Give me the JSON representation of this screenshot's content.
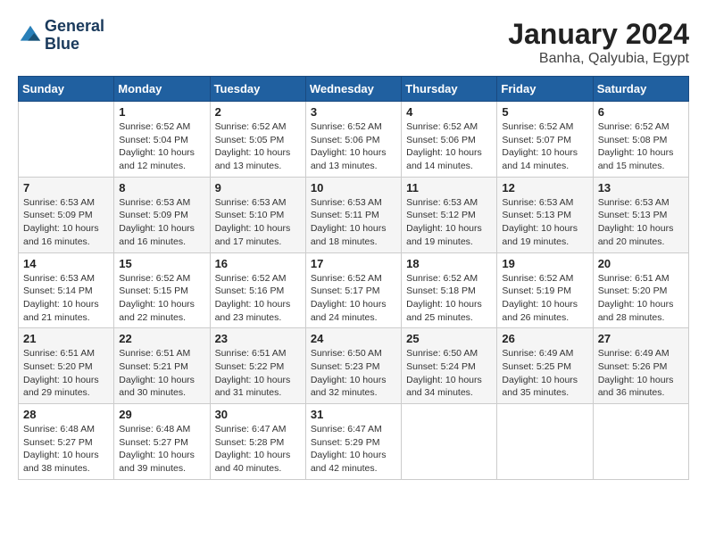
{
  "header": {
    "logo_line1": "General",
    "logo_line2": "Blue",
    "title": "January 2024",
    "subtitle": "Banha, Qalyubia, Egypt"
  },
  "columns": [
    "Sunday",
    "Monday",
    "Tuesday",
    "Wednesday",
    "Thursday",
    "Friday",
    "Saturday"
  ],
  "weeks": [
    [
      {
        "day": "",
        "sunrise": "",
        "sunset": "",
        "daylight": ""
      },
      {
        "day": "1",
        "sunrise": "Sunrise: 6:52 AM",
        "sunset": "Sunset: 5:04 PM",
        "daylight": "Daylight: 10 hours and 12 minutes."
      },
      {
        "day": "2",
        "sunrise": "Sunrise: 6:52 AM",
        "sunset": "Sunset: 5:05 PM",
        "daylight": "Daylight: 10 hours and 13 minutes."
      },
      {
        "day": "3",
        "sunrise": "Sunrise: 6:52 AM",
        "sunset": "Sunset: 5:06 PM",
        "daylight": "Daylight: 10 hours and 13 minutes."
      },
      {
        "day": "4",
        "sunrise": "Sunrise: 6:52 AM",
        "sunset": "Sunset: 5:06 PM",
        "daylight": "Daylight: 10 hours and 14 minutes."
      },
      {
        "day": "5",
        "sunrise": "Sunrise: 6:52 AM",
        "sunset": "Sunset: 5:07 PM",
        "daylight": "Daylight: 10 hours and 14 minutes."
      },
      {
        "day": "6",
        "sunrise": "Sunrise: 6:52 AM",
        "sunset": "Sunset: 5:08 PM",
        "daylight": "Daylight: 10 hours and 15 minutes."
      }
    ],
    [
      {
        "day": "7",
        "sunrise": "Sunrise: 6:53 AM",
        "sunset": "Sunset: 5:09 PM",
        "daylight": "Daylight: 10 hours and 16 minutes."
      },
      {
        "day": "8",
        "sunrise": "Sunrise: 6:53 AM",
        "sunset": "Sunset: 5:09 PM",
        "daylight": "Daylight: 10 hours and 16 minutes."
      },
      {
        "day": "9",
        "sunrise": "Sunrise: 6:53 AM",
        "sunset": "Sunset: 5:10 PM",
        "daylight": "Daylight: 10 hours and 17 minutes."
      },
      {
        "day": "10",
        "sunrise": "Sunrise: 6:53 AM",
        "sunset": "Sunset: 5:11 PM",
        "daylight": "Daylight: 10 hours and 18 minutes."
      },
      {
        "day": "11",
        "sunrise": "Sunrise: 6:53 AM",
        "sunset": "Sunset: 5:12 PM",
        "daylight": "Daylight: 10 hours and 19 minutes."
      },
      {
        "day": "12",
        "sunrise": "Sunrise: 6:53 AM",
        "sunset": "Sunset: 5:13 PM",
        "daylight": "Daylight: 10 hours and 19 minutes."
      },
      {
        "day": "13",
        "sunrise": "Sunrise: 6:53 AM",
        "sunset": "Sunset: 5:13 PM",
        "daylight": "Daylight: 10 hours and 20 minutes."
      }
    ],
    [
      {
        "day": "14",
        "sunrise": "Sunrise: 6:53 AM",
        "sunset": "Sunset: 5:14 PM",
        "daylight": "Daylight: 10 hours and 21 minutes."
      },
      {
        "day": "15",
        "sunrise": "Sunrise: 6:52 AM",
        "sunset": "Sunset: 5:15 PM",
        "daylight": "Daylight: 10 hours and 22 minutes."
      },
      {
        "day": "16",
        "sunrise": "Sunrise: 6:52 AM",
        "sunset": "Sunset: 5:16 PM",
        "daylight": "Daylight: 10 hours and 23 minutes."
      },
      {
        "day": "17",
        "sunrise": "Sunrise: 6:52 AM",
        "sunset": "Sunset: 5:17 PM",
        "daylight": "Daylight: 10 hours and 24 minutes."
      },
      {
        "day": "18",
        "sunrise": "Sunrise: 6:52 AM",
        "sunset": "Sunset: 5:18 PM",
        "daylight": "Daylight: 10 hours and 25 minutes."
      },
      {
        "day": "19",
        "sunrise": "Sunrise: 6:52 AM",
        "sunset": "Sunset: 5:19 PM",
        "daylight": "Daylight: 10 hours and 26 minutes."
      },
      {
        "day": "20",
        "sunrise": "Sunrise: 6:51 AM",
        "sunset": "Sunset: 5:20 PM",
        "daylight": "Daylight: 10 hours and 28 minutes."
      }
    ],
    [
      {
        "day": "21",
        "sunrise": "Sunrise: 6:51 AM",
        "sunset": "Sunset: 5:20 PM",
        "daylight": "Daylight: 10 hours and 29 minutes."
      },
      {
        "day": "22",
        "sunrise": "Sunrise: 6:51 AM",
        "sunset": "Sunset: 5:21 PM",
        "daylight": "Daylight: 10 hours and 30 minutes."
      },
      {
        "day": "23",
        "sunrise": "Sunrise: 6:51 AM",
        "sunset": "Sunset: 5:22 PM",
        "daylight": "Daylight: 10 hours and 31 minutes."
      },
      {
        "day": "24",
        "sunrise": "Sunrise: 6:50 AM",
        "sunset": "Sunset: 5:23 PM",
        "daylight": "Daylight: 10 hours and 32 minutes."
      },
      {
        "day": "25",
        "sunrise": "Sunrise: 6:50 AM",
        "sunset": "Sunset: 5:24 PM",
        "daylight": "Daylight: 10 hours and 34 minutes."
      },
      {
        "day": "26",
        "sunrise": "Sunrise: 6:49 AM",
        "sunset": "Sunset: 5:25 PM",
        "daylight": "Daylight: 10 hours and 35 minutes."
      },
      {
        "day": "27",
        "sunrise": "Sunrise: 6:49 AM",
        "sunset": "Sunset: 5:26 PM",
        "daylight": "Daylight: 10 hours and 36 minutes."
      }
    ],
    [
      {
        "day": "28",
        "sunrise": "Sunrise: 6:48 AM",
        "sunset": "Sunset: 5:27 PM",
        "daylight": "Daylight: 10 hours and 38 minutes."
      },
      {
        "day": "29",
        "sunrise": "Sunrise: 6:48 AM",
        "sunset": "Sunset: 5:27 PM",
        "daylight": "Daylight: 10 hours and 39 minutes."
      },
      {
        "day": "30",
        "sunrise": "Sunrise: 6:47 AM",
        "sunset": "Sunset: 5:28 PM",
        "daylight": "Daylight: 10 hours and 40 minutes."
      },
      {
        "day": "31",
        "sunrise": "Sunrise: 6:47 AM",
        "sunset": "Sunset: 5:29 PM",
        "daylight": "Daylight: 10 hours and 42 minutes."
      },
      {
        "day": "",
        "sunrise": "",
        "sunset": "",
        "daylight": ""
      },
      {
        "day": "",
        "sunrise": "",
        "sunset": "",
        "daylight": ""
      },
      {
        "day": "",
        "sunrise": "",
        "sunset": "",
        "daylight": ""
      }
    ]
  ]
}
